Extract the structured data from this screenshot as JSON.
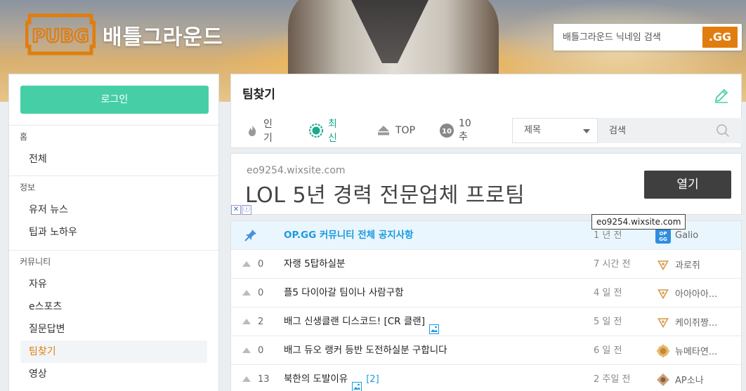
{
  "header": {
    "logo_text": "PUBG",
    "title": "배틀그라운드",
    "search_placeholder": "배틀그라운드 닉네임 검색",
    "search_button": ".GG"
  },
  "sidebar": {
    "login": "로그인",
    "sections": [
      {
        "head": "홈",
        "items": [
          "전체"
        ]
      },
      {
        "head": "정보",
        "items": [
          "유저 뉴스",
          "팁과 노하우"
        ]
      },
      {
        "head": "커뮤니티",
        "items": [
          "자유",
          "e스포츠",
          "질문답변",
          "팀찾기",
          "영상"
        ]
      }
    ],
    "active_item": "팀찾기"
  },
  "board": {
    "title": "팀찾기",
    "tabs": [
      {
        "label": "인기",
        "icon": "flame-icon"
      },
      {
        "label": "최신",
        "icon": "clock-icon"
      },
      {
        "label": "TOP",
        "icon": "arrow-up-icon"
      },
      {
        "label": "10추",
        "icon": "ten-badge-icon"
      }
    ],
    "active_tab": "최신",
    "filter_select": "제목",
    "filter_placeholder": "검색"
  },
  "ad": {
    "url": "eo9254.wixsite.com",
    "title": "LOL 5년 경력 전문업체 프로팀",
    "open_button": "열기",
    "tooltip": "eo9254.wixsite.com",
    "marks": [
      "✕",
      "ⓘ"
    ]
  },
  "posts": [
    {
      "notice": true,
      "votes": "",
      "subject": "OP.GG 커뮤니티 전체 공지사항",
      "image": false,
      "comments": "",
      "time": "1 년 전",
      "author": "Galio",
      "badge": "opgg"
    },
    {
      "notice": false,
      "votes": "0",
      "subject": "자랭 5탑하실분",
      "image": false,
      "comments": "",
      "time": "7 시간 전",
      "author": "과로쥐",
      "badge": "tier"
    },
    {
      "notice": false,
      "votes": "0",
      "subject": "플5 다이아갈 팀이나 사람구함",
      "image": false,
      "comments": "",
      "time": "4 일 전",
      "author": "아아아아...",
      "badge": "tier"
    },
    {
      "notice": false,
      "votes": "2",
      "subject": "배그 신생클랜 디스코드! [CR 클랜]",
      "image": true,
      "comments": "",
      "time": "5 일 전",
      "author": "케이쥐짱...",
      "badge": "tier"
    },
    {
      "notice": false,
      "votes": "0",
      "subject": "배그 듀오 랭커 등반 도전하실분 구합니다",
      "image": false,
      "comments": "",
      "time": "6 일 전",
      "author": "뉴메타연...",
      "badge": "gold"
    },
    {
      "notice": false,
      "votes": "13",
      "subject": "북한의 도발이유",
      "image": true,
      "comments": "[2]",
      "time": "2 주일 전",
      "author": "AP소나",
      "badge": "bronze"
    }
  ],
  "colors": {
    "accent_green": "#46cfa7",
    "accent_orange": "#e17d0e",
    "notice_blue": "#1a9ae0"
  }
}
